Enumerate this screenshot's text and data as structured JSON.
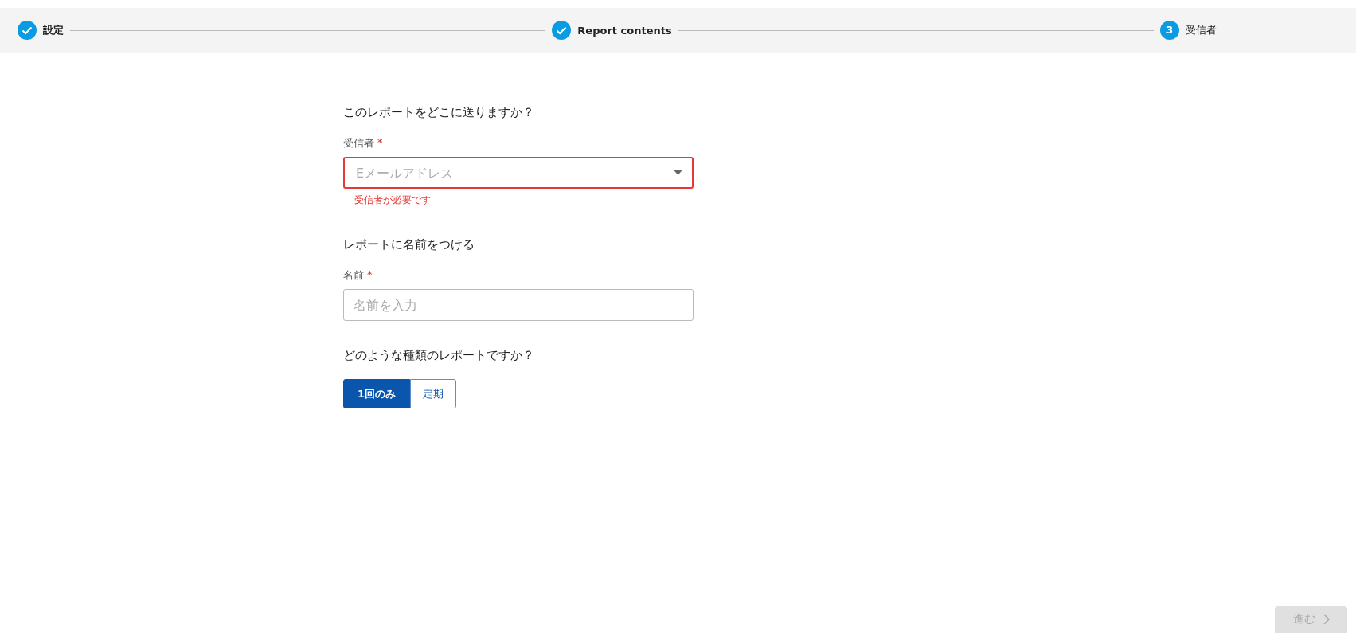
{
  "stepper": [
    {
      "kind": "done",
      "label": "設定"
    },
    {
      "kind": "done",
      "label": "Report contents"
    },
    {
      "kind": "current",
      "number": "3",
      "label": "受信者"
    }
  ],
  "recipient": {
    "heading": "このレポートをどこに送りますか？",
    "label": "受信者",
    "required_mark": "*",
    "placeholder": "Eメールアドレス",
    "dropdown": true,
    "error": "受信者が必要です"
  },
  "name": {
    "heading": "レポートに名前をつける",
    "label": "名前",
    "required_mark": "*",
    "placeholder": "名前を入力"
  },
  "report_type": {
    "heading": "どのような種類のレポートですか？",
    "options": [
      {
        "label": "1回のみ",
        "selected": true
      },
      {
        "label": "定期",
        "selected": false
      }
    ]
  },
  "next_button": {
    "label": "進む",
    "disabled": true
  }
}
